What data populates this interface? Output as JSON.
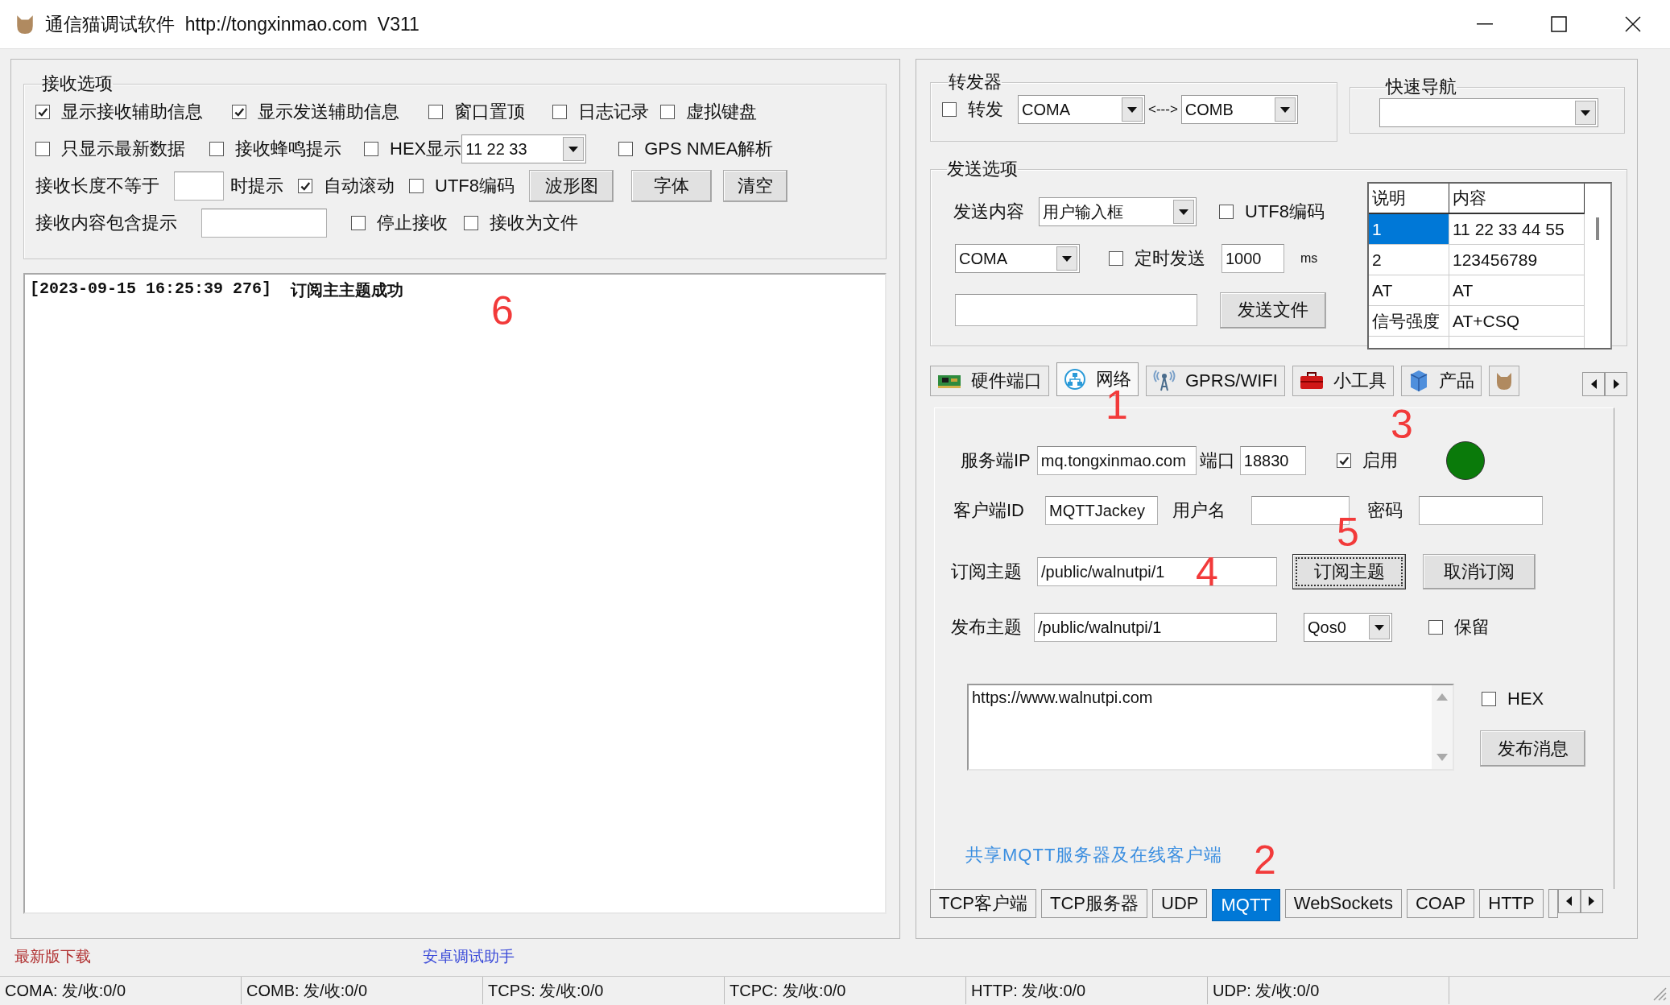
{
  "window": {
    "title": "通信猫调试软件  http://tongxinmao.com  V311"
  },
  "receive_options": {
    "title": "接收选项",
    "lines": [
      {
        "items": [
          {
            "kind": "checkbox",
            "label": "显示接收辅助信息",
            "checked": true
          },
          {
            "kind": "checkbox",
            "label": "显示发送辅助信息",
            "checked": true
          },
          {
            "kind": "checkbox",
            "label": "窗口置顶",
            "checked": false
          },
          {
            "kind": "checkbox",
            "label": "日志记录",
            "checked": false
          },
          {
            "kind": "checkbox",
            "label": "虚拟键盘",
            "checked": false
          }
        ]
      },
      {
        "items": [
          {
            "kind": "checkbox",
            "label": "只显示最新数据",
            "checked": false
          },
          {
            "kind": "checkbox",
            "label": "接收蜂鸣提示",
            "checked": false
          },
          {
            "kind": "checkbox",
            "label": "HEX显示",
            "checked": false
          },
          {
            "kind": "select",
            "value": "11 22 33"
          },
          {
            "kind": "checkbox",
            "label": "GPS NMEA解析",
            "checked": false
          }
        ]
      },
      {
        "items": [
          {
            "kind": "label",
            "label": "接收长度不等于"
          },
          {
            "kind": "field"
          },
          {
            "kind": "label",
            "label": "时提示"
          },
          {
            "kind": "checkbox",
            "label": "自动滚动",
            "checked": true
          },
          {
            "kind": "checkbox",
            "label": "UTF8编码",
            "checked": false
          },
          {
            "kind": "button",
            "label": "波形图"
          },
          {
            "kind": "button",
            "label": "字体"
          },
          {
            "kind": "button",
            "label": "清空"
          }
        ]
      },
      {
        "items": [
          {
            "kind": "label",
            "label": "接收内容包含提示"
          },
          {
            "kind": "field"
          },
          {
            "kind": "checkbox",
            "label": "停止接收",
            "checked": false
          },
          {
            "kind": "checkbox",
            "label": "接收为文件",
            "checked": false
          }
        ]
      }
    ]
  },
  "log": {
    "lines": [
      {
        "time": "[2023-09-15 16:25:39 276]",
        "message": "订阅主主题成功"
      }
    ]
  },
  "footer": {
    "download_link": "最新版下载",
    "android_link": "安卓调试助手"
  },
  "forwarder": {
    "title": "转发器",
    "label": "转发",
    "checked": false,
    "from": "COMA",
    "arrow": "<--->",
    "to": "COMB"
  },
  "quick_nav": {
    "title": "快速导航"
  },
  "send_options": {
    "title": "发送选项",
    "content_label": "发送内容",
    "content_source": "用户输入框",
    "utf8": {
      "label": "UTF8编码",
      "checked": false
    },
    "port": "COMA",
    "timed": {
      "label": "定时发送",
      "checked": false
    },
    "interval": "1000",
    "unit": "ms",
    "send_file_button": "发送文件",
    "table": {
      "columns": [
        "说明",
        "内容"
      ],
      "rows": [
        {
          "cells": [
            "1",
            "11 22 33 44 55"
          ],
          "selected": true
        },
        {
          "cells": [
            "2",
            "123456789"
          ],
          "selected": false
        },
        {
          "cells": [
            "AT",
            "AT"
          ],
          "selected": false
        },
        {
          "cells": [
            "信号强度",
            "AT+CSQ"
          ],
          "selected": false
        }
      ]
    }
  },
  "tabs": [
    {
      "kind": "hardware",
      "label": "硬件端口",
      "selected": false
    },
    {
      "kind": "network",
      "label": "网络",
      "selected": true
    },
    {
      "kind": "gprs",
      "label": "GPRS/WIFI",
      "selected": false
    },
    {
      "kind": "tools",
      "label": "小工具",
      "selected": false
    },
    {
      "kind": "product",
      "label": "产品",
      "selected": false
    },
    {
      "kind": "more",
      "selected": false
    }
  ],
  "mqtt": {
    "server_ip_label": "服务端IP",
    "server_ip": "mq.tongxinmao.com",
    "port_label": "端口",
    "port": "18830",
    "enable": {
      "label": "启用",
      "checked": true
    },
    "connected": true,
    "client_id_label": "客户端ID",
    "client_id": "MQTTJackey",
    "username_label": "用户名",
    "password_label": "密码",
    "subscribe_label": "订阅主题",
    "subscribe_topic": "/public/walnutpi/1",
    "subscribe_button": "订阅主题",
    "unsubscribe_button": "取消订阅",
    "publish_label": "发布主题",
    "publish_topic": "/public/walnutpi/1",
    "qos": "Qos0",
    "retain": {
      "label": "保留",
      "checked": false
    },
    "message": "https://www.walnutpi.com",
    "hex": {
      "label": "HEX",
      "checked": false
    },
    "publish_button": "发布消息",
    "share_link": "共享MQTT服务器及在线客户端"
  },
  "protocol_tabs": [
    {
      "label": "TCP客户端",
      "selected": false
    },
    {
      "label": "TCP服务器",
      "selected": false
    },
    {
      "label": "UDP",
      "selected": false
    },
    {
      "label": "MQTT",
      "selected": true
    },
    {
      "label": "WebSockets",
      "selected": false
    },
    {
      "label": "COAP",
      "selected": false
    },
    {
      "label": "HTTP",
      "selected": false
    }
  ],
  "annotations": [
    "1",
    "2",
    "3",
    "4",
    "5",
    "6"
  ],
  "status_bar": [
    "COMA: 发/收:0/0",
    "COMB: 发/收:0/0",
    "TCPS: 发/收:0/0",
    "TCPC: 发/收:0/0",
    "HTTP: 发/收:0/0",
    "UDP: 发/收:0/0"
  ]
}
